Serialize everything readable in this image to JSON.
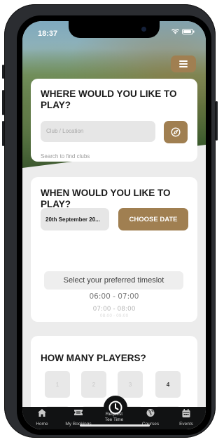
{
  "status": {
    "time": "18:37"
  },
  "menu": {
    "icon": "hamburger-menu-icon"
  },
  "where": {
    "title": "WHERE WOULD YOU LIKE TO PLAY?",
    "placeholder": "Club / Location",
    "hint": "Search to find clubs",
    "locate_icon": "compass-icon"
  },
  "when": {
    "title": "WHEN WOULD YOU LIKE TO PLAY?",
    "date": "20th September 20...",
    "choose_label": "CHOOSE DATE",
    "slot_title": "Select your preferred timeslot",
    "slots": [
      "06:00 - 07:00",
      "07:00 - 08:00",
      "08:00 - 09:00"
    ]
  },
  "players": {
    "title": "HOW MANY PLAYERS?",
    "options": [
      "1",
      "2",
      "3",
      "4"
    ],
    "selected": "4"
  },
  "tabbar": {
    "items": [
      {
        "label": "Home",
        "icon": "home-icon"
      },
      {
        "label": "My Bookings",
        "icon": "ticket-icon"
      },
      {
        "label": "Request\nTee Time",
        "icon": "clock-icon"
      },
      {
        "label": "Courses",
        "icon": "globe-icon"
      },
      {
        "label": "Events",
        "icon": "calendar-icon"
      }
    ]
  },
  "colors": {
    "accent": "#a07f51",
    "tabbar": "#111213",
    "background": "#ececec"
  }
}
